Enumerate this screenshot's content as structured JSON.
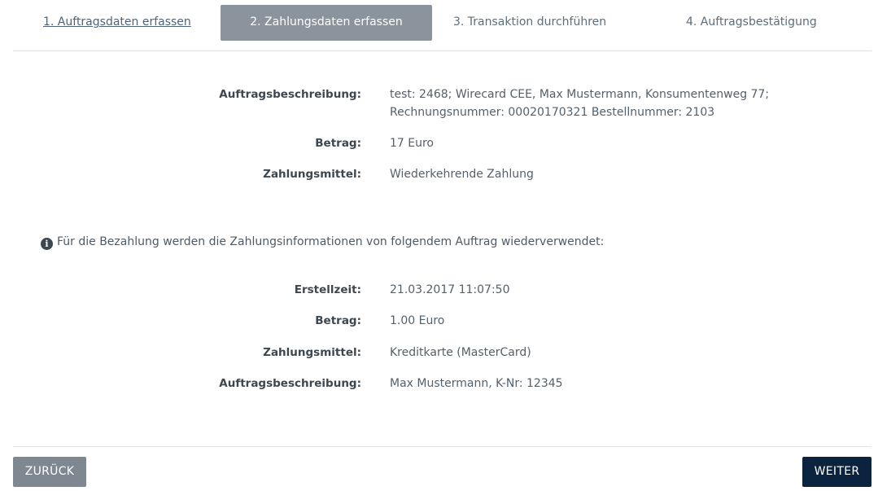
{
  "steps": [
    {
      "label": "1. Auftragsdaten erfassen",
      "state": "done"
    },
    {
      "label": "2. Zahlungsdaten erfassen",
      "state": "active"
    },
    {
      "label": "3. Transaktion durchführen",
      "state": "pending"
    },
    {
      "label": "4. Auftragsbestätigung",
      "state": "pending"
    }
  ],
  "order": {
    "description_label": "Auftragsbeschreibung:",
    "description_line1": "test: 2468; Wirecard CEE, Max Mustermann, Konsumentenweg 77;",
    "description_line2": "Rechnungsnummer: 00020170321 Bestellnummer: 2103",
    "amount_label": "Betrag:",
    "amount": "17 Euro",
    "payment_label": "Zahlungsmittel:",
    "payment": "Wiederkehrende Zahlung"
  },
  "info": {
    "icon": "info-circle-icon",
    "text": "Für die Bezahlung werden die Zahlungsinformationen von folgendem Auftrag wiederverwendet:"
  },
  "previous": {
    "created_label": "Erstellzeit:",
    "created": "21.03.2017 11:07:50",
    "amount_label": "Betrag:",
    "amount": "1.00 Euro",
    "payment_label": "Zahlungsmittel:",
    "payment": "Kreditkarte (MasterCard)",
    "description_label": "Auftragsbeschreibung:",
    "description": "Max Mustermann, K-Nr: 12345"
  },
  "buttons": {
    "back": "ZURÜCK",
    "next": "WEITER"
  },
  "colors": {
    "active_step": "#8b939c",
    "back_button": "#7f8891",
    "next_button": "#0c2340"
  }
}
